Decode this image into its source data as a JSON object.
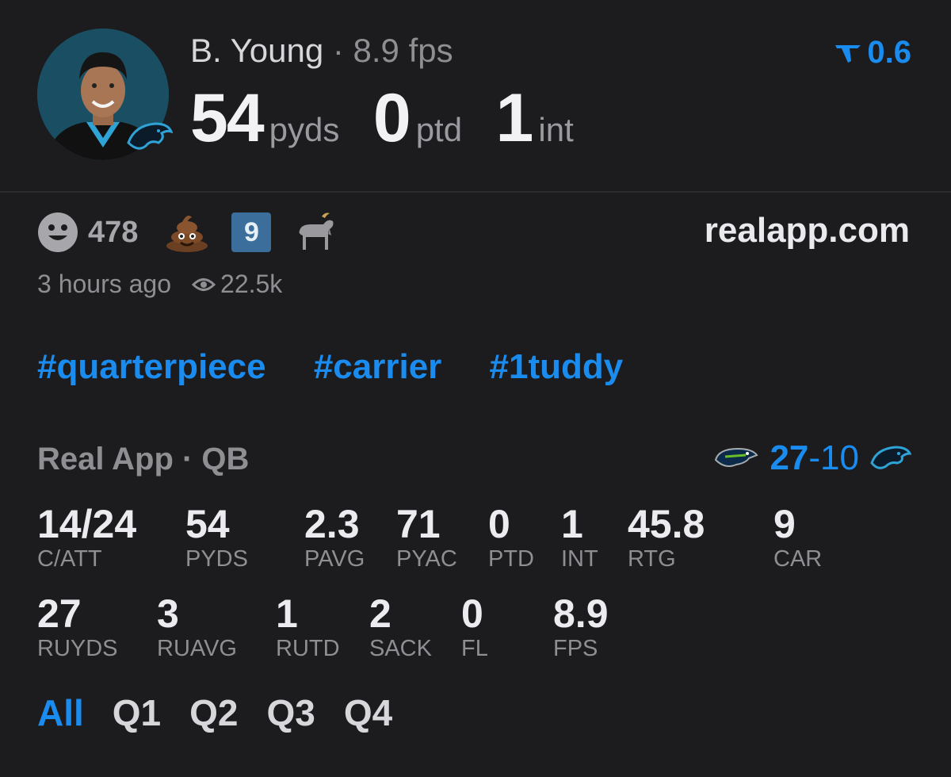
{
  "player": {
    "name": "B. Young",
    "separator": "·",
    "fps_label": "8.9 fps",
    "passing_yards": "54",
    "passing_yards_unit": "pyds",
    "passing_td": "0",
    "passing_td_unit": "ptd",
    "interceptions": "1",
    "interceptions_unit": "int"
  },
  "rating_badge": {
    "value": "0.6",
    "color": "#1a8cf0"
  },
  "reactions": {
    "smiley_count": "478",
    "emoji_icons": [
      "smiley-icon",
      "poop-icon",
      "nine-badge-icon",
      "goat-icon"
    ],
    "nine_badge": "9"
  },
  "site": "realapp.com",
  "meta": {
    "time_ago": "3 hours ago",
    "views": "22.5k"
  },
  "hashtags": [
    "#quarterpiece",
    "#carrier",
    "#1tuddy"
  ],
  "game": {
    "title": "Real App · QB",
    "score_home": "27",
    "score_dash": "-",
    "score_away": "10"
  },
  "stats": [
    {
      "value": "14/24",
      "label": "C/ATT"
    },
    {
      "value": "54",
      "label": "PYDS"
    },
    {
      "value": "2.3",
      "label": "PAVG"
    },
    {
      "value": "71",
      "label": "PYAC"
    },
    {
      "value": "0",
      "label": "PTD"
    },
    {
      "value": "1",
      "label": "INT"
    },
    {
      "value": "45.8",
      "label": "RTG"
    },
    {
      "value": "9",
      "label": "CAR"
    },
    {
      "value": "27",
      "label": "RUYDS"
    },
    {
      "value": "3",
      "label": "RUAVG"
    },
    {
      "value": "1",
      "label": "RUTD"
    },
    {
      "value": "2",
      "label": "SACK"
    },
    {
      "value": "0",
      "label": "FL"
    },
    {
      "value": "8.9",
      "label": "FPS"
    }
  ],
  "tabs": [
    "All",
    "Q1",
    "Q2",
    "Q3",
    "Q4"
  ],
  "colors": {
    "accent": "#1a8cf0",
    "background": "#1c1c1e"
  }
}
